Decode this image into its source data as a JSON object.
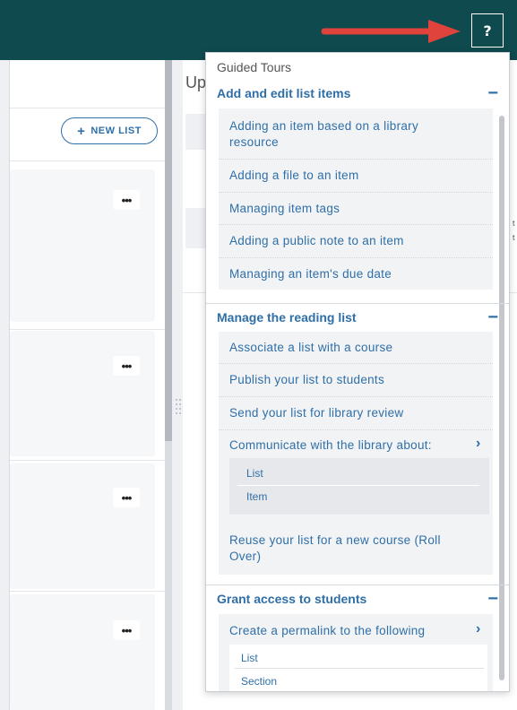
{
  "header": {
    "help_button": {
      "label": "?",
      "icon": "question-mark-icon"
    },
    "pointer_arrow": {
      "color": "#e0433b"
    },
    "background_color": "#0e4a4e"
  },
  "left_panel": {
    "new_list_button": {
      "label": "NEW LIST",
      "icon": "plus-icon"
    },
    "more_actions_label": "•••"
  },
  "right_panel": {
    "title_fragment": "Up",
    "edge_fragment_1": "t",
    "edge_fragment_2": "t"
  },
  "guided_tours": {
    "title": "Guided Tours",
    "sections": [
      {
        "label": "Add and edit list items",
        "collapse_icon": "−",
        "items": [
          {
            "label": "Adding an item based on a library resource"
          },
          {
            "label": "Adding a file to an item"
          },
          {
            "label": "Managing item tags"
          },
          {
            "label": "Adding a public note to an item"
          },
          {
            "label": "Managing an item's due date"
          }
        ]
      },
      {
        "label": "Manage the reading list",
        "collapse_icon": "−",
        "items": [
          {
            "label": "Associate a list with a course"
          },
          {
            "label": "Publish your list to students"
          },
          {
            "label": "Send your list for library review"
          },
          {
            "label": "Communicate with the library about:",
            "chevron": "›",
            "sub_items": [
              "List",
              "Item"
            ]
          },
          {
            "label": "Reuse your list for a new course (Roll Over)"
          }
        ]
      },
      {
        "label": "Grant access to students",
        "collapse_icon": "−",
        "items": [
          {
            "label": "Create a permalink to the following",
            "chevron": "›",
            "sub_items": [
              "List",
              "Section"
            ]
          }
        ]
      }
    ]
  },
  "colors": {
    "accent": "#2f6fa8",
    "header": "#0e4a4e",
    "arrow": "#e0433b"
  }
}
